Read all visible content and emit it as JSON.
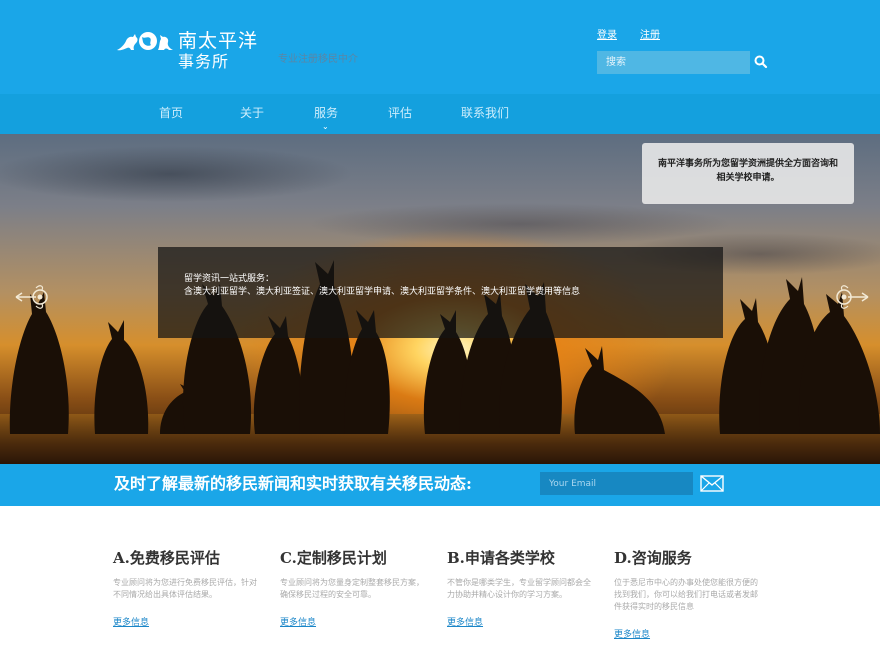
{
  "brand": {
    "title": "南太平洋",
    "subtitle": "事务所",
    "tagline": "专业注册移民中介"
  },
  "auth": {
    "login": "登录",
    "register": "注册"
  },
  "search": {
    "placeholder": "搜索"
  },
  "nav": {
    "items": [
      {
        "label": "首页"
      },
      {
        "label": "关于"
      },
      {
        "label": "服务"
      },
      {
        "label": "评估"
      },
      {
        "label": "联系我们"
      }
    ],
    "caret": "⌄"
  },
  "hero": {
    "notice": "南平洋事务所为您留学资洲提供全方面咨询和相关学校申请。",
    "caption_line1": "留学资讯一站式服务：",
    "caption_line2": "含澳大利亚留学、澳大利亚签证、澳大利亚留学申请、澳大利亚留学条件、澳大利亚留学费用等信息"
  },
  "newsletter": {
    "text": "及时了解最新的移民新闻和实时获取有关移民动态:",
    "email_placeholder": "Your Email"
  },
  "services": [
    {
      "title": "A.免费移民评估",
      "desc": "专业顾问将为您进行免费移民评估，针对不同情况给出具体评估结果。",
      "link": "更多信息"
    },
    {
      "title": "C.定制移民计划",
      "desc": "专业顾问将为您量身定制整套移民方案，确保移民过程的安全可靠。",
      "link": "更多信息"
    },
    {
      "title": "B.申请各类学校",
      "desc": "不管你是哪类学生，专业留学顾问都会全力协助并精心设计你的学习方案。",
      "link": "更多信息"
    },
    {
      "title": "D.咨询服务",
      "desc": "位于悉尼市中心的办事处使您能很方便的找到我们，你可以给我们打电话或者发邮件获得实时的移民信息",
      "link": "更多信息"
    }
  ],
  "colors": {
    "header_blue": "#1aa6e8",
    "nav_blue": "#14a0de",
    "link_blue": "#1a86c8"
  },
  "icons": {
    "logo": "kangaroo-globe-logo",
    "search": "magnifier-icon",
    "mail": "envelope-icon",
    "prev": "ornate-arrow-left-icon",
    "next": "ornate-arrow-right-icon"
  }
}
